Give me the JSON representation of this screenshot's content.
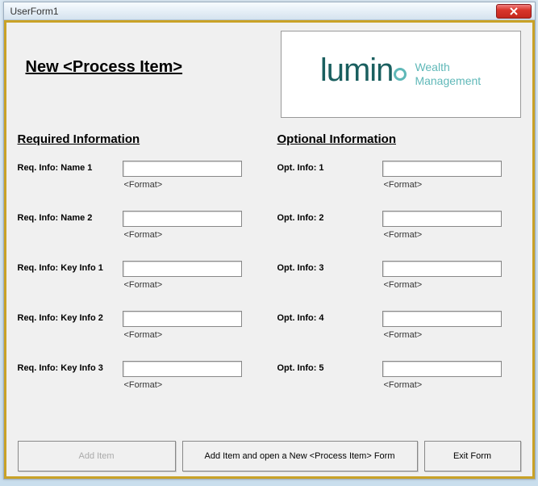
{
  "window": {
    "title": "UserForm1"
  },
  "header": {
    "title": "New <Process Item>",
    "logo": {
      "word": "lumin",
      "tagline1": "Wealth",
      "tagline2": "Management"
    }
  },
  "sections": {
    "required": {
      "title": "Required Information",
      "fields": [
        {
          "label": "Req. Info: Name 1",
          "value": "",
          "hint": "<Format>"
        },
        {
          "label": "Req. Info: Name 2",
          "value": "",
          "hint": "<Format>"
        },
        {
          "label": "Req. Info: Key Info 1",
          "value": "",
          "hint": "<Format>"
        },
        {
          "label": "Req. Info: Key Info 2",
          "value": "",
          "hint": "<Format>"
        },
        {
          "label": "Req. Info: Key Info 3",
          "value": "",
          "hint": "<Format>"
        }
      ]
    },
    "optional": {
      "title": "Optional Information",
      "fields": [
        {
          "label": "Opt. Info: 1",
          "value": "",
          "hint": "<Format>"
        },
        {
          "label": "Opt. Info: 2",
          "value": "",
          "hint": "<Format>"
        },
        {
          "label": "Opt. Info: 3",
          "value": "",
          "hint": "<Format>"
        },
        {
          "label": "Opt. Info: 4",
          "value": "",
          "hint": "<Format>"
        },
        {
          "label": "Opt. Info: 5",
          "value": "",
          "hint": "<Format>"
        }
      ]
    }
  },
  "buttons": {
    "add": "Add Item",
    "addNew": "Add Item and open a New <Process Item>  Form",
    "exit": "Exit Form"
  }
}
